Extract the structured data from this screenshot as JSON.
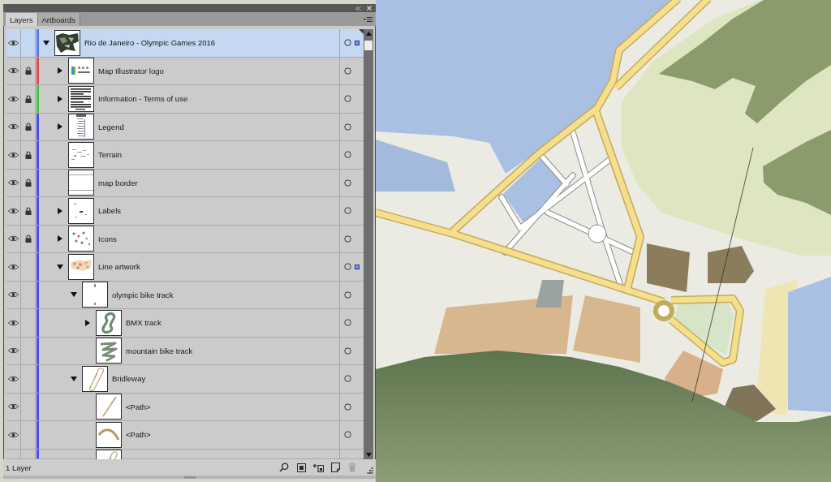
{
  "panel": {
    "tabs": [
      {
        "label": "Layers",
        "selected": true
      },
      {
        "label": "Artboards",
        "selected": false
      }
    ],
    "layers": [
      {
        "kind": "layer",
        "name": "Rio de Janeiro - Olympic Games 2016",
        "thumbnail": {
          "kind": "map"
        },
        "visible": true,
        "locked": false,
        "selected": true,
        "has_selection": true,
        "expanded": true,
        "color": "#5a78ee",
        "children": [
          {
            "kind": "layer",
            "name": "Map Illustrator logo",
            "thumbnail": {
              "kind": "logo"
            },
            "visible": true,
            "locked": true,
            "selected": false,
            "has_selection": false,
            "expanded": false,
            "color": "#e24a4a"
          },
          {
            "kind": "layer",
            "name": "Information - Terms of use",
            "thumbnail": {
              "kind": "document"
            },
            "visible": true,
            "locked": true,
            "selected": false,
            "has_selection": false,
            "expanded": false,
            "color": "#47c447"
          },
          {
            "kind": "layer",
            "name": "Legend",
            "thumbnail": {
              "kind": "legend"
            },
            "visible": true,
            "locked": true,
            "selected": false,
            "has_selection": false,
            "expanded": false,
            "color": "#4b4bef"
          },
          {
            "kind": "layer",
            "name": "Terrain",
            "thumbnail": {
              "kind": "sketch"
            },
            "visible": true,
            "locked": true,
            "selected": false,
            "has_selection": false,
            "color": "#4b4bef"
          },
          {
            "kind": "layer",
            "name": "map border",
            "thumbnail": {
              "kind": "border"
            },
            "visible": true,
            "locked": true,
            "selected": false,
            "has_selection": false,
            "color": "#4b4bef"
          },
          {
            "kind": "layer",
            "name": "Labels",
            "thumbnail": {
              "kind": "labels"
            },
            "visible": true,
            "locked": true,
            "selected": false,
            "has_selection": false,
            "expanded": false,
            "color": "#4b4bef"
          },
          {
            "kind": "layer",
            "name": "Icons",
            "thumbnail": {
              "kind": "icons"
            },
            "visible": true,
            "locked": true,
            "selected": false,
            "has_selection": false,
            "expanded": false,
            "color": "#4b4bef"
          },
          {
            "kind": "layer",
            "name": "Line artwork",
            "thumbnail": {
              "kind": "artwork"
            },
            "visible": true,
            "locked": false,
            "selected": false,
            "has_selection": true,
            "expanded": true,
            "color": "#4b4bef",
            "children": [
              {
                "kind": "layer",
                "name": "olympic bike track",
                "thumbnail": {
                  "kind": "marks"
                },
                "visible": true,
                "locked": false,
                "selected": false,
                "has_selection": false,
                "expanded": true,
                "children": [
                  {
                    "kind": "layer",
                    "name": "BMX track",
                    "thumbnail": {
                      "kind": "squiggle"
                    },
                    "visible": true,
                    "locked": false,
                    "selected": false,
                    "has_selection": false,
                    "expanded": false
                  },
                  {
                    "kind": "layer",
                    "name": "mountain bike track",
                    "thumbnail": {
                      "kind": "zigzag"
                    },
                    "visible": true,
                    "locked": false,
                    "selected": false,
                    "has_selection": false
                  }
                ]
              },
              {
                "kind": "layer",
                "name": "Bridleway",
                "thumbnail": {
                  "kind": "loop"
                },
                "visible": true,
                "locked": false,
                "selected": false,
                "has_selection": false,
                "expanded": true,
                "children": [
                  {
                    "kind": "layer",
                    "name": "<Path>",
                    "thumbnail": {
                      "kind": "line"
                    },
                    "visible": true,
                    "locked": false,
                    "selected": false,
                    "has_selection": false
                  },
                  {
                    "kind": "layer",
                    "name": "<Path>",
                    "thumbnail": {
                      "kind": "curve"
                    },
                    "visible": true,
                    "locked": false,
                    "selected": false,
                    "has_selection": false
                  },
                  {
                    "kind": "cut-off",
                    "thumbnail": {
                      "kind": "loop"
                    }
                  }
                ]
              }
            ]
          }
        ]
      }
    ],
    "footer": {
      "status": "1 Layer",
      "buttons": [
        {
          "kind": "locate",
          "disabled": false
        },
        {
          "kind": "clip",
          "disabled": false
        },
        {
          "kind": "sublayer",
          "disabled": false
        },
        {
          "kind": "new",
          "disabled": false
        },
        {
          "kind": "delete",
          "disabled": true
        }
      ]
    }
  }
}
